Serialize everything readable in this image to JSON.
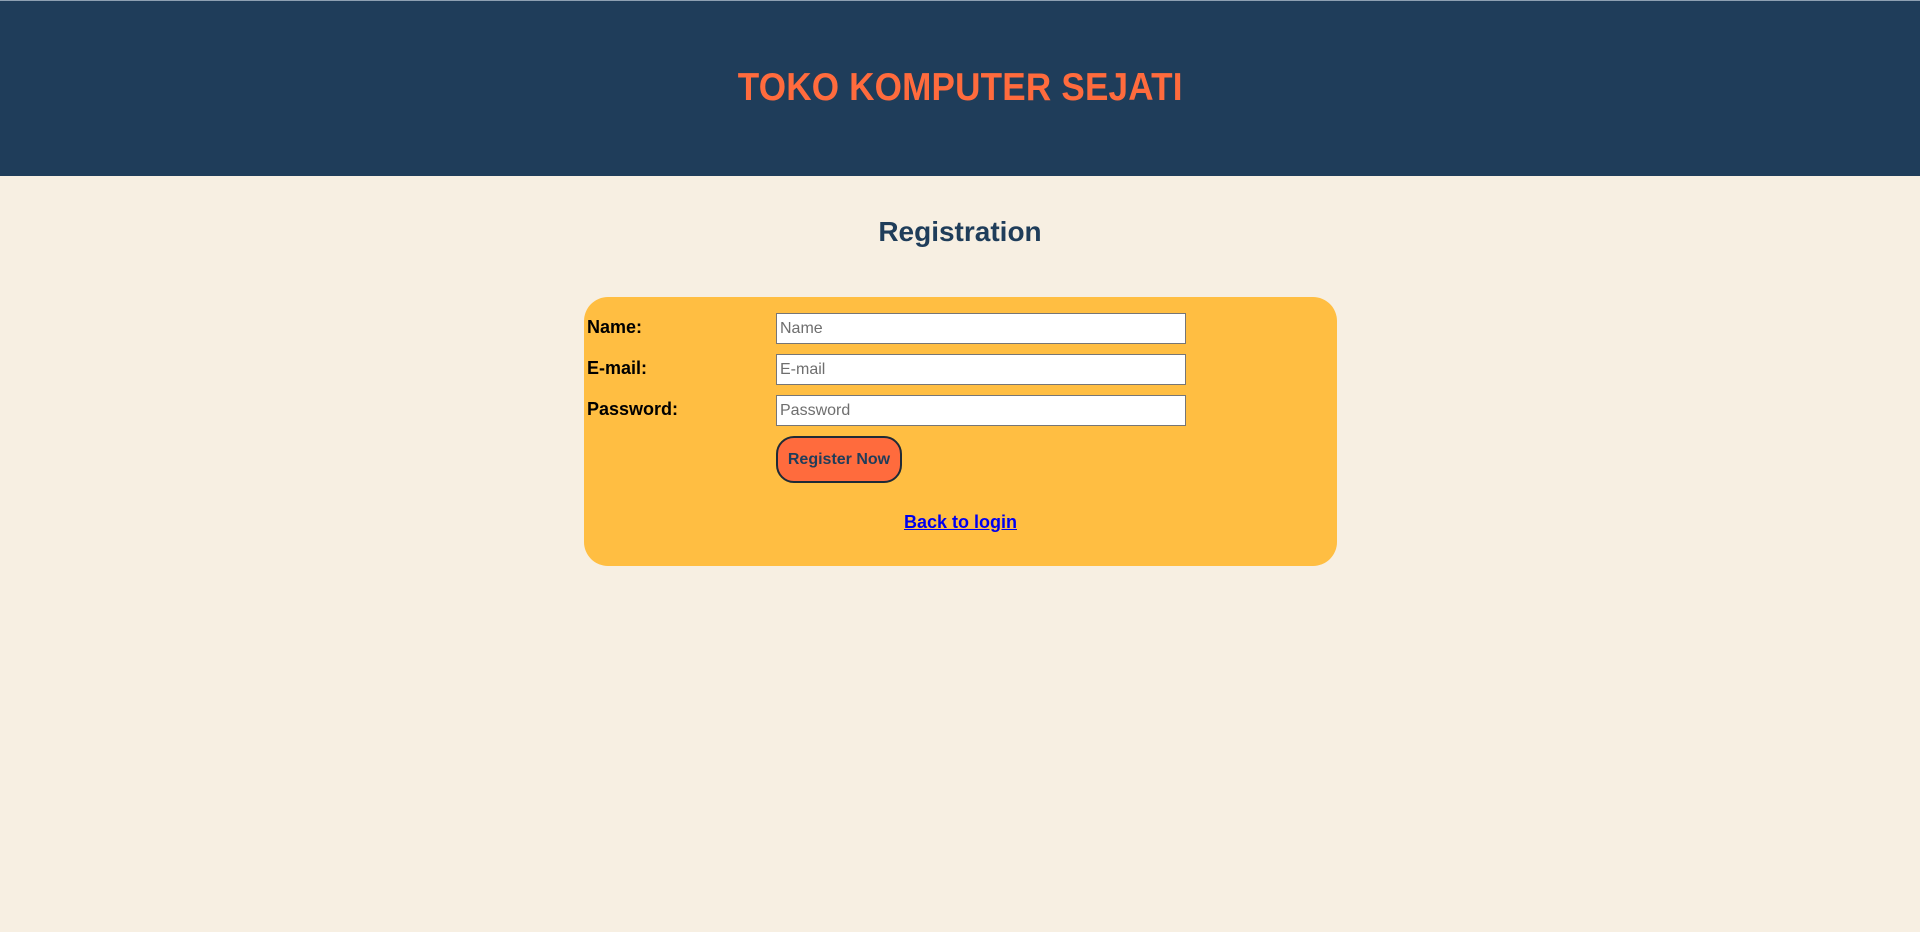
{
  "header": {
    "title": "TOKO KOMPUTER SEJATI"
  },
  "page": {
    "title": "Registration"
  },
  "form": {
    "name": {
      "label": "Name:",
      "placeholder": "Name",
      "value": ""
    },
    "email": {
      "label": "E-mail:",
      "placeholder": "E-mail",
      "value": ""
    },
    "password": {
      "label": "Password:",
      "placeholder": "Password",
      "value": ""
    },
    "submit_label": "Register Now",
    "back_link": "Back to login"
  },
  "colors": {
    "header_bg": "#1f3d5a",
    "brand_accent": "#ff6b3d",
    "page_bg": "#f7efe2",
    "card_bg": "#ffbe42",
    "link": "#0000ee"
  }
}
